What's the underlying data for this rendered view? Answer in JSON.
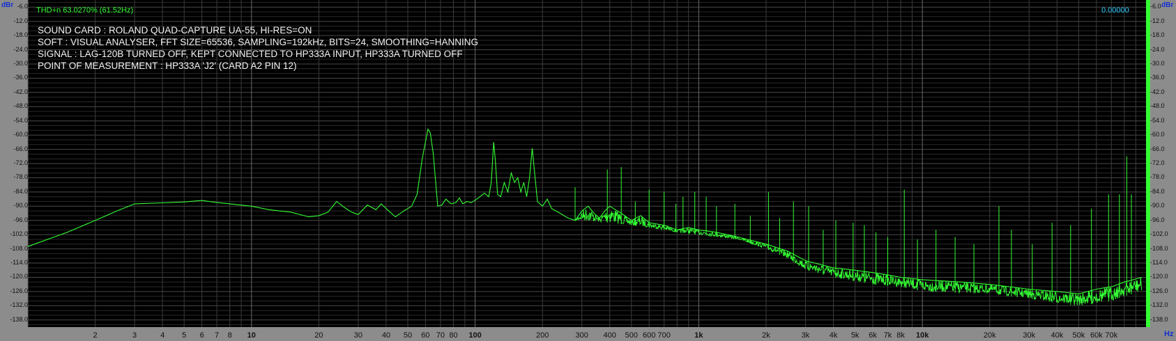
{
  "header": {
    "y_unit_left": "dBr",
    "y_unit_right": "dBr",
    "x_unit": "Hz",
    "thd_readout": "THD+n 63.0270% (61.52Hz)",
    "value_readout": "0.00000"
  },
  "annotations": [
    "SOUND CARD : ROLAND QUAD-CAPTURE UA-55, HI-RES=ON",
    "SOFT : VISUAL ANALYSER, FFT SIZE=65536, SAMPLING=192kHz, BITS=24, SMOOTHING=HANNING",
    "SIGNAL : LAG-120B TURNED OFF, KEPT CONNECTED TO HP333A INPUT, HP333A TURNED OFF",
    "POINT OF MEASUREMENT : HP333A 'J2' (CARD A2 PIN 12)"
  ],
  "colors": {
    "background": "#000000",
    "grid": "#3c3c3c",
    "trace": "#33ff33",
    "level_bar": "#33ff33",
    "panel": "#8c8c8c"
  },
  "chart_data": {
    "type": "line",
    "title": "",
    "xlabel": "Hz",
    "ylabel": "dBr",
    "x_scale": "log",
    "xlim": [
      1,
      100000
    ],
    "ylim": [
      -141,
      -3
    ],
    "grid": true,
    "y_ticks": [
      "-6.0",
      "-12.0",
      "-18.0",
      "-24.0",
      "-30.0",
      "-36.0",
      "-42.0",
      "-48.0",
      "-54.0",
      "-60.0",
      "-66.0",
      "-72.0",
      "-78.0",
      "-84.0",
      "-90.0",
      "-96.0",
      "-102.0",
      "-108.0",
      "-114.0",
      "-120.0",
      "-126.0",
      "-132.0",
      "-138.0"
    ],
    "x_ticks": [
      {
        "label": "2",
        "value": 2
      },
      {
        "label": "3",
        "value": 3
      },
      {
        "label": "4",
        "value": 4
      },
      {
        "label": "5",
        "value": 5
      },
      {
        "label": "6",
        "value": 6
      },
      {
        "label": "7",
        "value": 7
      },
      {
        "label": "8",
        "value": 8
      },
      {
        "label": "10",
        "value": 10,
        "major": true
      },
      {
        "label": "20",
        "value": 20
      },
      {
        "label": "30",
        "value": 30
      },
      {
        "label": "40",
        "value": 40
      },
      {
        "label": "50",
        "value": 50
      },
      {
        "label": "60",
        "value": 60
      },
      {
        "label": "70",
        "value": 70
      },
      {
        "label": "80",
        "value": 80
      },
      {
        "label": "100",
        "value": 100,
        "major": true
      },
      {
        "label": "200",
        "value": 200
      },
      {
        "label": "300",
        "value": 300
      },
      {
        "label": "400",
        "value": 400
      },
      {
        "label": "500",
        "value": 500
      },
      {
        "label": "600",
        "value": 600
      },
      {
        "label": "700",
        "value": 700
      },
      {
        "label": "1k",
        "value": 1000,
        "major": true
      },
      {
        "label": "2k",
        "value": 2000
      },
      {
        "label": "3k",
        "value": 3000
      },
      {
        "label": "4k",
        "value": 4000
      },
      {
        "label": "5k",
        "value": 5000
      },
      {
        "label": "6k",
        "value": 6000
      },
      {
        "label": "7k",
        "value": 7000
      },
      {
        "label": "8k",
        "value": 8000
      },
      {
        "label": "10k",
        "value": 10000,
        "major": true
      },
      {
        "label": "20k",
        "value": 20000
      },
      {
        "label": "30k",
        "value": 30000
      },
      {
        "label": "40k",
        "value": 40000
      },
      {
        "label": "50k",
        "value": 50000
      },
      {
        "label": "60k",
        "value": 60000
      },
      {
        "label": "70k",
        "value": 70000
      }
    ],
    "series": [
      {
        "points": [
          [
            1,
            -107
          ],
          [
            1.5,
            -101
          ],
          [
            2,
            -96
          ],
          [
            2.5,
            -92
          ],
          [
            3,
            -89
          ],
          [
            4,
            -88.6
          ],
          [
            5,
            -88.2
          ],
          [
            6,
            -87.6
          ],
          [
            7,
            -88.4
          ],
          [
            8,
            -89
          ],
          [
            10,
            -90
          ],
          [
            12,
            -91.5
          ],
          [
            15,
            -92.5
          ],
          [
            18,
            -94.5
          ],
          [
            20,
            -94
          ],
          [
            22,
            -92.5
          ],
          [
            24,
            -88
          ],
          [
            26,
            -90.5
          ],
          [
            28,
            -92.5
          ],
          [
            30,
            -93.5
          ],
          [
            33,
            -89.5
          ],
          [
            36,
            -91.5
          ],
          [
            38,
            -89
          ],
          [
            40,
            -91
          ],
          [
            44,
            -94.5
          ],
          [
            48,
            -92
          ],
          [
            52,
            -90
          ],
          [
            55,
            -85
          ],
          [
            58,
            -70
          ],
          [
            61.5,
            -57.5
          ],
          [
            63,
            -59
          ],
          [
            65,
            -68
          ],
          [
            68,
            -90
          ],
          [
            71,
            -89.5
          ],
          [
            74,
            -87
          ],
          [
            78,
            -89
          ],
          [
            82,
            -88.5
          ],
          [
            85,
            -86.5
          ],
          [
            88,
            -89
          ],
          [
            92,
            -88
          ],
          [
            96,
            -88.5
          ],
          [
            100,
            -87.5
          ],
          [
            105,
            -86
          ],
          [
            110,
            -84.5
          ],
          [
            115,
            -86
          ],
          [
            118,
            -80
          ],
          [
            121,
            -63
          ],
          [
            123,
            -70
          ],
          [
            126,
            -85
          ],
          [
            130,
            -86
          ],
          [
            135,
            -80
          ],
          [
            140,
            -84
          ],
          [
            145,
            -76
          ],
          [
            150,
            -80
          ],
          [
            155,
            -78
          ],
          [
            160,
            -84
          ],
          [
            165,
            -80
          ],
          [
            170,
            -86
          ],
          [
            175,
            -78
          ],
          [
            180,
            -65.5
          ],
          [
            184,
            -75
          ],
          [
            190,
            -88
          ],
          [
            200,
            -90
          ],
          [
            210,
            -87
          ],
          [
            220,
            -91
          ],
          [
            240,
            -93
          ],
          [
            260,
            -95
          ],
          [
            280,
            -96
          ],
          [
            300,
            -92
          ],
          [
            320,
            -90
          ],
          [
            340,
            -93
          ],
          [
            360,
            -95
          ],
          [
            380,
            -92
          ],
          [
            400,
            -90
          ],
          [
            450,
            -93
          ],
          [
            500,
            -96
          ],
          [
            550,
            -94
          ],
          [
            600,
            -97
          ],
          [
            700,
            -98
          ],
          [
            800,
            -100
          ],
          [
            900,
            -99
          ],
          [
            1000,
            -100
          ],
          [
            1200,
            -101
          ],
          [
            1500,
            -103
          ],
          [
            2000,
            -106
          ],
          [
            2500,
            -109
          ],
          [
            3000,
            -113
          ],
          [
            4000,
            -116
          ],
          [
            5000,
            -117
          ],
          [
            6000,
            -118
          ],
          [
            7000,
            -119
          ],
          [
            8000,
            -120
          ],
          [
            10000,
            -121
          ],
          [
            15000,
            -122
          ],
          [
            20000,
            -123
          ],
          [
            30000,
            -125
          ],
          [
            40000,
            -126
          ],
          [
            50000,
            -127
          ],
          [
            60000,
            -125
          ],
          [
            70000,
            -124
          ],
          [
            80000,
            -122
          ],
          [
            96000,
            -120
          ]
        ]
      }
    ],
    "spikes": [
      [
        280,
        -82
      ],
      [
        390,
        -74.5
      ],
      [
        450,
        -73.5
      ],
      [
        520,
        -88
      ],
      [
        600,
        -83
      ],
      [
        700,
        -84
      ],
      [
        790,
        -89
      ],
      [
        850,
        -86
      ],
      [
        960,
        -84
      ],
      [
        1080,
        -86
      ],
      [
        1200,
        -90
      ],
      [
        1450,
        -89
      ],
      [
        1700,
        -94
      ],
      [
        2050,
        -84
      ],
      [
        2300,
        -95
      ],
      [
        2650,
        -88
      ],
      [
        3100,
        -90
      ],
      [
        3600,
        -100
      ],
      [
        4100,
        -96
      ],
      [
        4900,
        -97
      ],
      [
        5500,
        -98
      ],
      [
        6200,
        -101
      ],
      [
        7000,
        -103
      ],
      [
        8300,
        -83
      ],
      [
        9500,
        -104
      ],
      [
        11500,
        -100
      ],
      [
        14000,
        -103
      ],
      [
        17000,
        -106
      ],
      [
        22000,
        -90
      ],
      [
        25000,
        -100
      ],
      [
        31000,
        -106
      ],
      [
        38000,
        -97
      ],
      [
        46000,
        -98
      ],
      [
        57000,
        -91
      ],
      [
        68000,
        -85
      ],
      [
        76000,
        -85
      ],
      [
        82000,
        -69
      ],
      [
        86000,
        -85
      ]
    ],
    "noise_floor": [
      [
        280,
        -96
      ],
      [
        400,
        -97
      ],
      [
        600,
        -99
      ],
      [
        800,
        -101
      ],
      [
        1000,
        -102
      ],
      [
        1500,
        -104
      ],
      [
        2000,
        -108
      ],
      [
        2500,
        -112
      ],
      [
        3000,
        -117
      ],
      [
        4000,
        -120
      ],
      [
        6000,
        -123
      ],
      [
        8000,
        -124
      ],
      [
        10000,
        -126
      ],
      [
        20000,
        -127
      ],
      [
        30000,
        -129
      ],
      [
        40000,
        -131
      ],
      [
        50000,
        -132
      ],
      [
        60000,
        -131
      ],
      [
        70000,
        -130
      ],
      [
        80000,
        -128
      ],
      [
        96000,
        -126
      ]
    ]
  }
}
